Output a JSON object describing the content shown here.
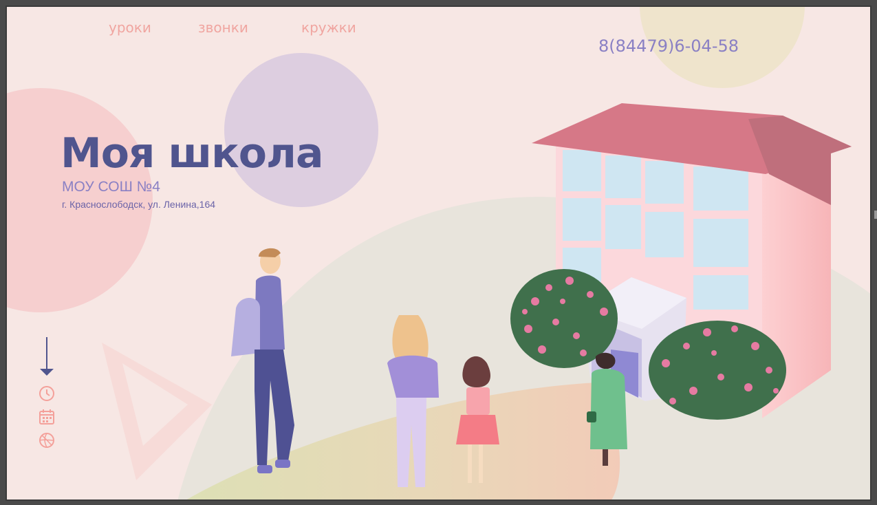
{
  "nav": {
    "items": [
      {
        "label": "уроки"
      },
      {
        "label": "звонки"
      },
      {
        "label": "кружки"
      }
    ]
  },
  "header": {
    "phone": "8(84479)6-04-58"
  },
  "hero": {
    "title": "Моя школа",
    "subtitle": "МОУ СОШ №4",
    "address": "г. Краснослободск, ул. Ленина,164"
  },
  "side_icons": [
    "arrow-down-icon",
    "clock-icon",
    "calendar-icon",
    "ball-icon"
  ],
  "colors": {
    "background": "#f7e7e4",
    "nav_text": "#f0a5a0",
    "title": "#50558e",
    "accent": "#8a80c4",
    "roof": "#d87484",
    "building": "#fbc1c3"
  }
}
